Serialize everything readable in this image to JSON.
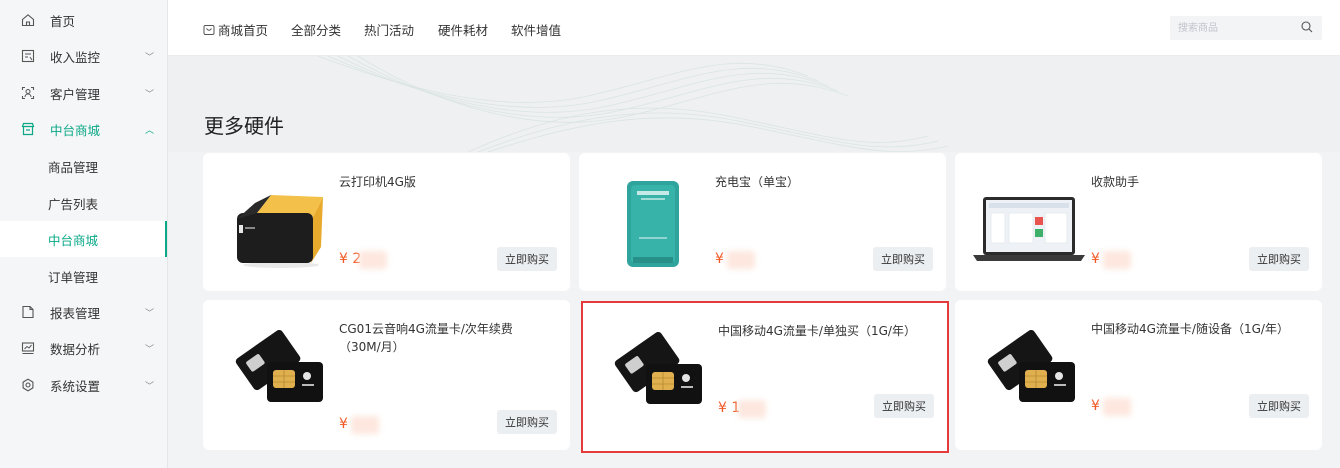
{
  "sidebar": {
    "items": [
      {
        "label": "首页",
        "icon": "home-icon"
      },
      {
        "label": "收入监控",
        "icon": "monitor-icon",
        "chevron": "﹀"
      },
      {
        "label": "客户管理",
        "icon": "customer-icon",
        "chevron": "﹀"
      },
      {
        "label": "中台商城",
        "icon": "shop-icon",
        "chevron": "︿",
        "active": true
      },
      {
        "label": "商品管理"
      },
      {
        "label": "广告列表"
      },
      {
        "label": "中台商城",
        "selected": true
      },
      {
        "label": "订单管理"
      },
      {
        "label": "报表管理",
        "icon": "report-icon",
        "chevron": "﹀"
      },
      {
        "label": "数据分析",
        "icon": "analytics-icon",
        "chevron": "﹀"
      },
      {
        "label": "系统设置",
        "icon": "settings-icon",
        "chevron": "﹀"
      }
    ]
  },
  "topnav": {
    "items": [
      "商城首页",
      "全部分类",
      "热门活动",
      "硬件耗材",
      "软件增值"
    ],
    "search_placeholder": "搜索商品"
  },
  "main": {
    "title": "更多硬件",
    "buy_label": "立即购买",
    "products": [
      {
        "name": "云打印机4G版",
        "price": "¥ 2",
        "image": "printer"
      },
      {
        "name": "充电宝（单宝）",
        "price": "¥",
        "image": "powerbank"
      },
      {
        "name": "收款助手",
        "price": "¥",
        "image": "laptop"
      },
      {
        "name": "CG01云音响4G流量卡/次年续费（30M/月）",
        "price": "¥",
        "image": "simcard"
      },
      {
        "name": "中国移动4G流量卡/单独买（1G/年）",
        "price": "¥ 1",
        "image": "simcard"
      },
      {
        "name": "中国移动4G流量卡/随设备（1G/年）",
        "price": "¥",
        "image": "simcard"
      }
    ]
  },
  "colors": {
    "accent": "#0aa887",
    "price": "#f05a28",
    "highlight": "#e33b3b"
  }
}
